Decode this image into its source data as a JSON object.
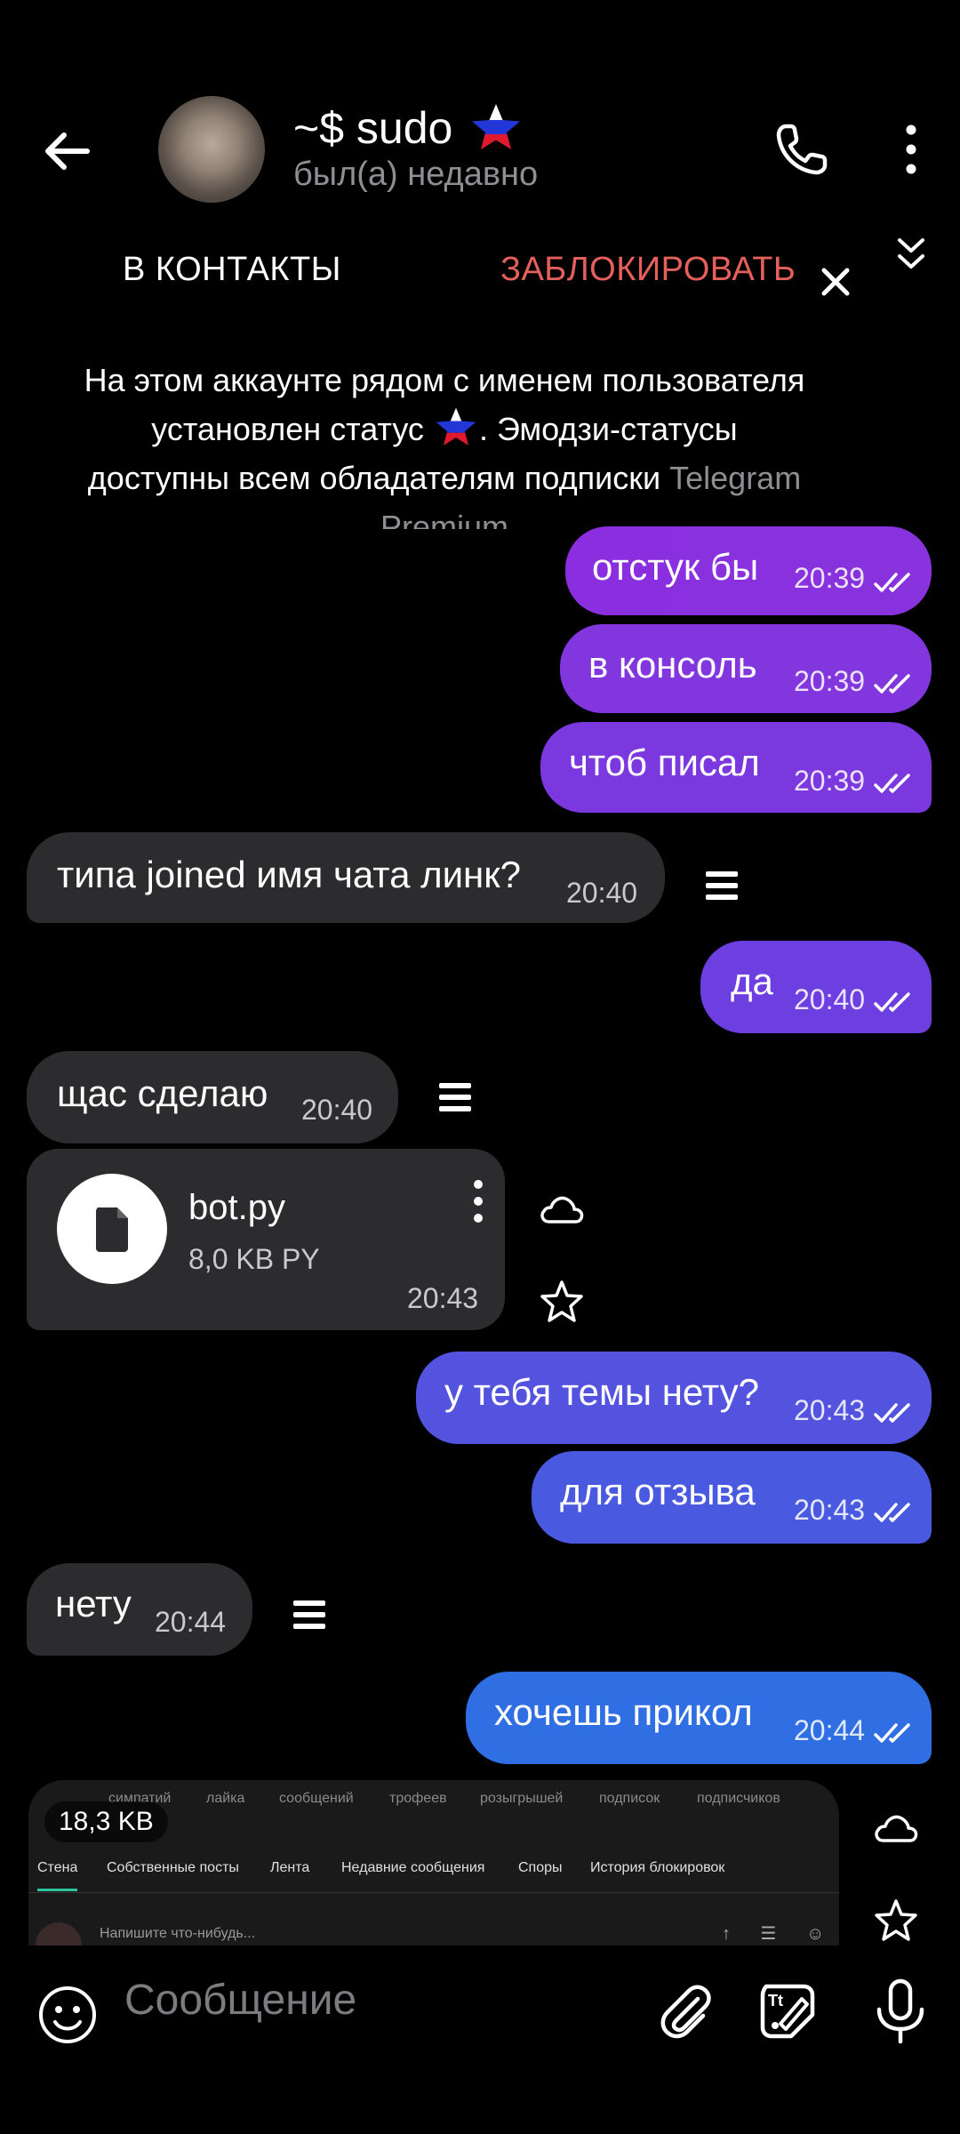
{
  "header": {
    "title": "~$ sudo",
    "status": "был(а) недавно",
    "add_contact": "В КОНТАКТЫ",
    "block": "ЗАБЛОКИРОВАТЬ",
    "icons": [
      "arrow-back-icon",
      "phone-icon",
      "more-vertical-icon",
      "double-chevron-down-icon",
      "close-icon",
      "russia-star-emoji-status-icon"
    ]
  },
  "notice": {
    "line1": "На этом аккаунте рядом с именем пользователя",
    "line2a": "установлен статус",
    "line2b": ". Эмодзи-статусы",
    "line3a": "доступны всем обладателям подписки",
    "line3b": "Telegram",
    "line4": "Premium"
  },
  "messages": [
    {
      "dir": "out",
      "text": "отстук бы",
      "time": "20:39"
    },
    {
      "dir": "out",
      "text": "в консоль",
      "time": "20:39"
    },
    {
      "dir": "out",
      "text": "чтоб писал",
      "time": "20:39"
    },
    {
      "dir": "in",
      "text": "типа joined имя чата линк?",
      "time": "20:40"
    },
    {
      "dir": "out",
      "text": "да",
      "time": "20:40"
    },
    {
      "dir": "in",
      "text": "щас сделаю",
      "time": "20:40"
    },
    {
      "dir": "in",
      "type": "file",
      "name": "bot.py",
      "size": "8,0 KB PY",
      "time": "20:43"
    },
    {
      "dir": "out",
      "text": "у тебя темы нету?",
      "time": "20:43"
    },
    {
      "dir": "out",
      "text": "для отзыва",
      "time": "20:43"
    },
    {
      "dir": "in",
      "text": "нету",
      "time": "20:44"
    },
    {
      "dir": "out",
      "text": "хочешь прикол",
      "time": "20:44"
    }
  ],
  "preview": {
    "size": "18,3 KB",
    "stats": [
      "симпатий",
      "лайка",
      "сообщений",
      "трофеев",
      "розыгрышей",
      "подписок",
      "подписчиков"
    ],
    "tabs": [
      "Стена",
      "Собственные посты",
      "Лента",
      "Недавние сообщения",
      "Споры",
      "История блокировок"
    ],
    "input_placeholder": "Напишите что-нибудь..."
  },
  "input": {
    "placeholder": "Сообщение"
  },
  "colors": {
    "background": "#000000",
    "incoming_bubble": "#2c2c2e",
    "outgoing_top": "#8a2be2",
    "outgoing_bottom": "#2f6fe3",
    "block_red": "#e5605b",
    "secondary_text": "#8e8e93"
  }
}
